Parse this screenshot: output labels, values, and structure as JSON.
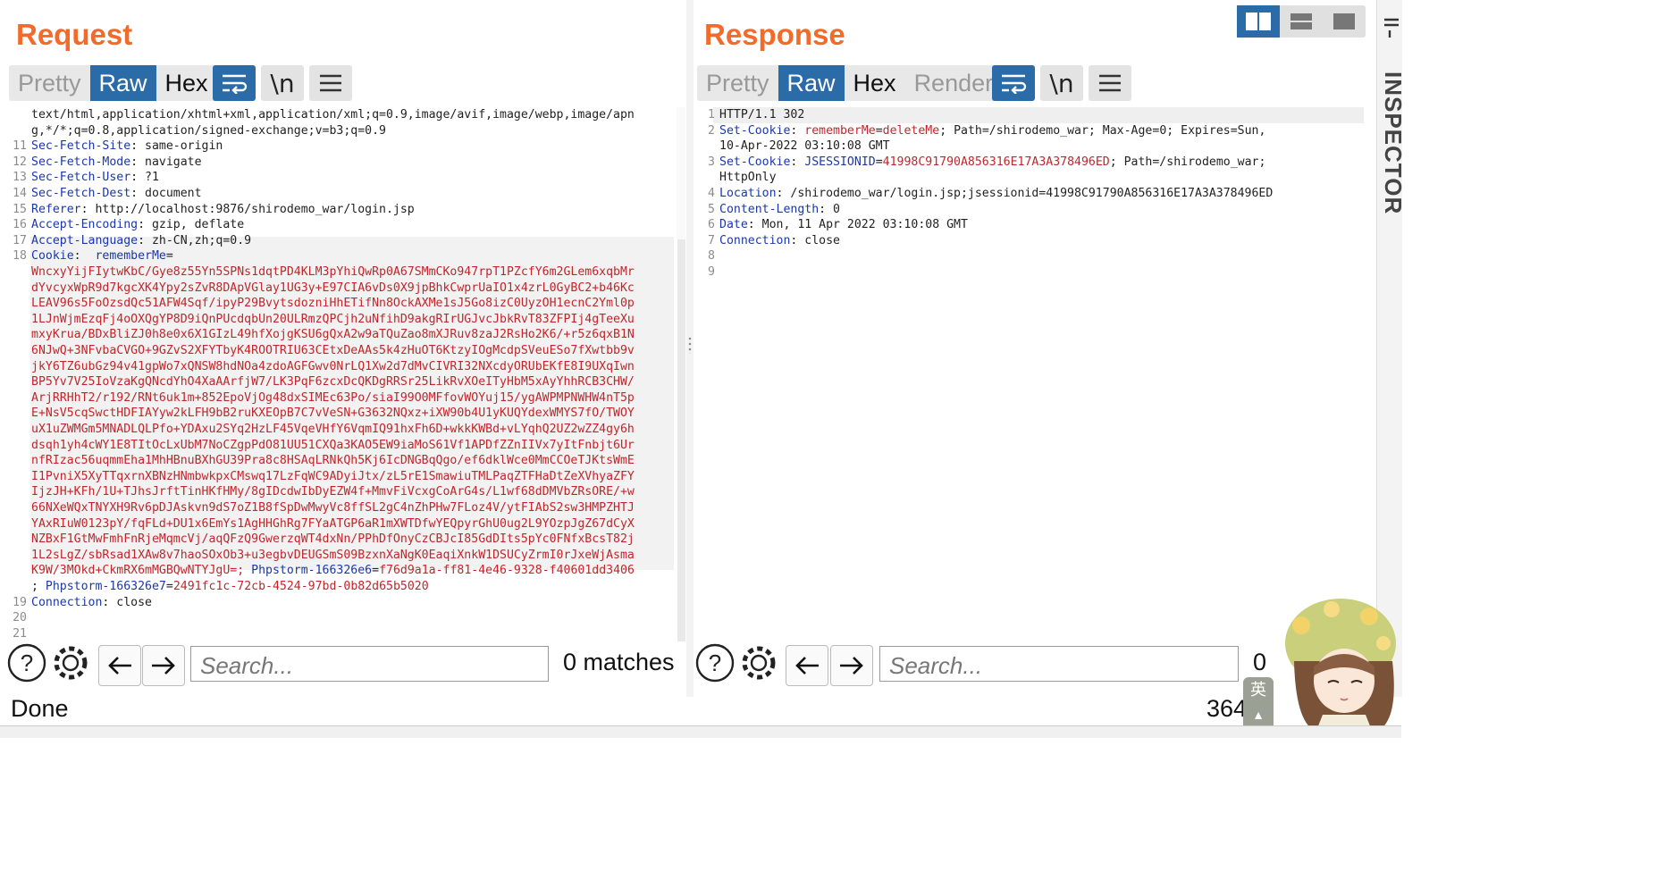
{
  "request": {
    "title": "Request",
    "tabs": [
      "Pretty",
      "Raw",
      "Hex"
    ],
    "active_tab": "Raw",
    "newline_label": "\\n",
    "lines": [
      {
        "n": "",
        "parts": [
          [
            "v",
            "text/html,application/xhtml+xml,application/xml;q=0.9,image/avif,image/webp,image/apn"
          ]
        ]
      },
      {
        "n": "",
        "parts": [
          [
            "v",
            "g,*/*;q=0.8,application/signed-exchange;v=b3;q=0.9"
          ]
        ]
      },
      {
        "n": "11",
        "parts": [
          [
            "k",
            "Sec-Fetch-Site"
          ],
          [
            "v",
            ": same-origin"
          ]
        ]
      },
      {
        "n": "12",
        "parts": [
          [
            "k",
            "Sec-Fetch-Mode"
          ],
          [
            "v",
            ": navigate"
          ]
        ]
      },
      {
        "n": "13",
        "parts": [
          [
            "k",
            "Sec-Fetch-User"
          ],
          [
            "v",
            ": ?1"
          ]
        ]
      },
      {
        "n": "14",
        "parts": [
          [
            "k",
            "Sec-Fetch-Dest"
          ],
          [
            "v",
            ": document"
          ]
        ]
      },
      {
        "n": "15",
        "parts": [
          [
            "k",
            "Referer"
          ],
          [
            "v",
            ": http://localhost:9876/shirodemo_war/login.jsp"
          ]
        ]
      },
      {
        "n": "16",
        "parts": [
          [
            "k",
            "Accept-Encoding"
          ],
          [
            "v",
            ": gzip, deflate"
          ]
        ]
      },
      {
        "n": "17",
        "parts": [
          [
            "k",
            "Accept-Language"
          ],
          [
            "v",
            ": zh-CN,zh;q=0.9"
          ]
        ]
      },
      {
        "n": "18",
        "parts": [
          [
            "k",
            "Cookie"
          ],
          [
            "v",
            ":  "
          ],
          [
            "k",
            "rememberMe"
          ],
          [
            "v",
            "="
          ]
        ]
      },
      {
        "n": "",
        "parts": [
          [
            "r",
            "WncxyYijFIytwKbC/Gye8z55Yn5SPNs1dqtPD4KLM3pYhiQwRp0A67SMmCKo947rpT1PZcfY6m2GLem6xqbMr"
          ]
        ]
      },
      {
        "n": "",
        "parts": [
          [
            "r",
            "dYvcyxWpR9d7kgcXK4Ypy2sZvR8DApVGlay1UG3y+E97CIA6vDs0X9jpBhkCwprUaIO1x4zrL0GyBC2+b46Kc"
          ]
        ]
      },
      {
        "n": "",
        "parts": [
          [
            "r",
            "LEAV96s5FoOzsdQc51AFW4Sqf/ipyP29BvytsdozniHhETifNn8OckAXMe1sJ5Go8izC0UyzOH1ecnC2Yml0p"
          ]
        ]
      },
      {
        "n": "",
        "parts": [
          [
            "r",
            "1LJnWjmEzqFj4oOXQgYP8D9iQnPUcdqbUn20ULRmzQPCjh2uNfihD9akgRIrUGJvcJbkRvT83ZFPIj4gTeeXu"
          ]
        ]
      },
      {
        "n": "",
        "parts": [
          [
            "r",
            "mxyKrua/BDxBliZJ0h8e0x6X1GIzL49hfXojgKSU6gQxA2w9aTQuZao8mXJRuv8zaJ2RsHo2K6/+r5z6qxB1N"
          ]
        ]
      },
      {
        "n": "",
        "parts": [
          [
            "r",
            "6NJwQ+3NFvbaCVGO+9GZvS2XFYTbyK4ROOTRIU63CEtxDeAAs5k4zHuOT6KtzyIOgMcdpSVeuESo7fXwtbb9v"
          ]
        ]
      },
      {
        "n": "",
        "parts": [
          [
            "r",
            "jkY6TZ6ubGz94v41gpWo7xQNSW8hdNOa4zdoAGFGwv0NrLQ1Xw2d7dMvCIVRI32NXcdyORUbEKfE8I9UXqIwn"
          ]
        ]
      },
      {
        "n": "",
        "parts": [
          [
            "r",
            "BP5Yv7V25IoVzaKgQNcdYhO4XaAArfjW7/LK3PqF6zcxDcQKDgRRSr25LikRvXOeITyHbM5xAyYhhRCB3CHW/"
          ]
        ]
      },
      {
        "n": "",
        "parts": [
          [
            "r",
            "ArjRRHhT2/r192/RNt6uk1m+852EpoVjOg48dxSIMEc63Po/siaI99O0MFfovWOYuj15/ygAWPMPNWHW4nT5p"
          ]
        ]
      },
      {
        "n": "",
        "parts": [
          [
            "r",
            "E+NsV5cqSwctHDFIAYyw2kLFH9bB2ruKXEOpB7C7vVeSN+G3632NQxz+iXW90b4U1yKUQYdexWMYS7fO/TWOY"
          ]
        ]
      },
      {
        "n": "",
        "parts": [
          [
            "r",
            "uX1uZWMGm5MNADLQLPfo+YDAxu2SYq2HzLF45VqeVHfY6VqmIQ91hxFh6D+wkkKWBd+vLYqhQ2UZ2wZZ4gy6h"
          ]
        ]
      },
      {
        "n": "",
        "parts": [
          [
            "r",
            "dsqh1yh4cWY1E8TItOcLxUbM7NoCZgpPdO81UU51CXQa3KAO5EW9iaMoS61Vf1APDfZZnIIVx7yItFnbjt6Ur"
          ]
        ]
      },
      {
        "n": "",
        "parts": [
          [
            "r",
            "nfRIzac56uqmmEha1MhHBnuBXhGU39Pra8c8HSAqLRNkQh5Kj6IcDNGBqQgo/ef6dklWce0MmCCOeTJKtsWmE"
          ]
        ]
      },
      {
        "n": "",
        "parts": [
          [
            "r",
            "I1PvniX5XyTTqxrnXBNzHNmbwkpxCMswq17LzFqWC9ADyiJtx/zL5rE1SmawiuTMLPaqZTFHaDtZeXVhyaZFY"
          ]
        ]
      },
      {
        "n": "",
        "parts": [
          [
            "r",
            "IjzJH+KFh/1U+TJhsJrftTinHKfHMy/8gIDcdwIbDyEZW4f+MmvFiVcxgCoArG4s/L1wf68dDMVbZRsORE/+w"
          ]
        ]
      },
      {
        "n": "",
        "parts": [
          [
            "r",
            "66NXeWQxTNYXH9Rv6pDJAskvn9dS7oZ1B8fSpDwMwyVc8ffSL2gC4nZhPHw7FLoz4V/ytFIAbS2sw3HMPZHTJ"
          ]
        ]
      },
      {
        "n": "",
        "parts": [
          [
            "r",
            "YAxRIuW0123pY/fqFLd+DU1x6EmYs1AgHHGhRg7FYaATGP6aR1mXWTDfwYEQpyrGhU0ug2L9YOzpJgZ67dCyX"
          ]
        ]
      },
      {
        "n": "",
        "parts": [
          [
            "r",
            "NZBxF1GtMwFmhFnRjeMqmcVj/aqQFzQ9GwerzqWT4dxNn/PPhDfOnyCzCBJcI85GdDIts5pYc0FNfxBcsT82j"
          ]
        ]
      },
      {
        "n": "",
        "parts": [
          [
            "r",
            "1L2sLgZ/sbRsad1XAw8v7haoSOxOb3+u3egbvDEUGSmS09BzxnXaNgK0EaqiXnkW1DSUCyZrmI0rJxeWjAsma"
          ]
        ]
      },
      {
        "n": "",
        "parts": [
          [
            "r",
            "K9W/3MOkd+CkmRX6mMGBQwNTYJgU=; "
          ],
          [
            "k",
            "Phpstorm-166326e6"
          ],
          [
            "v",
            "="
          ],
          [
            "r",
            "f76d9a1a-ff81-4e46-9328-f40601dd3406"
          ]
        ]
      },
      {
        "n": "",
        "parts": [
          [
            "v",
            "; "
          ],
          [
            "k",
            "Phpstorm-166326e7"
          ],
          [
            "v",
            "="
          ],
          [
            "r",
            "2491fc1c-72cb-4524-97bd-0b82d65b5020"
          ]
        ]
      },
      {
        "n": "19",
        "parts": [
          [
            "k",
            "Connection"
          ],
          [
            "v",
            ": close"
          ]
        ]
      },
      {
        "n": "20",
        "parts": []
      },
      {
        "n": "21",
        "parts": []
      }
    ],
    "search_placeholder": "Search...",
    "matches": "0 matches"
  },
  "response": {
    "title": "Response",
    "tabs": [
      "Pretty",
      "Raw",
      "Hex",
      "Render"
    ],
    "active_tab": "Raw",
    "newline_label": "\\n",
    "lines": [
      {
        "n": "1",
        "parts": [
          [
            "v",
            "HTTP/1.1 302"
          ]
        ]
      },
      {
        "n": "2",
        "parts": [
          [
            "k",
            "Set-Cookie"
          ],
          [
            "v",
            ": "
          ],
          [
            "r",
            "rememberMe"
          ],
          [
            "v",
            "="
          ],
          [
            "r",
            "deleteMe"
          ],
          [
            "v",
            "; Path=/shirodemo_war; Max-Age=0; Expires=Sun,"
          ]
        ]
      },
      {
        "n": "",
        "parts": [
          [
            "v",
            "10-Apr-2022 03:10:08 GMT"
          ]
        ]
      },
      {
        "n": "3",
        "parts": [
          [
            "k",
            "Set-Cookie"
          ],
          [
            "v",
            ": "
          ],
          [
            "k",
            "JSESSIONID"
          ],
          [
            "v",
            "="
          ],
          [
            "r",
            "41998C91790A856316E17A3A378496ED"
          ],
          [
            "v",
            "; Path=/shirodemo_war;"
          ]
        ]
      },
      {
        "n": "",
        "parts": [
          [
            "v",
            "HttpOnly"
          ]
        ]
      },
      {
        "n": "4",
        "parts": [
          [
            "k",
            "Location"
          ],
          [
            "v",
            ": /shirodemo_war/login.jsp;jsessionid=41998C91790A856316E17A3A378496ED"
          ]
        ]
      },
      {
        "n": "5",
        "parts": [
          [
            "k",
            "Content-Length"
          ],
          [
            "v",
            ": 0"
          ]
        ]
      },
      {
        "n": "6",
        "parts": [
          [
            "k",
            "Date"
          ],
          [
            "v",
            ": Mon, 11 Apr 2022 03:10:08 GMT"
          ]
        ]
      },
      {
        "n": "7",
        "parts": [
          [
            "k",
            "Connection"
          ],
          [
            "v",
            ": close"
          ]
        ]
      },
      {
        "n": "8",
        "parts": []
      },
      {
        "n": "9",
        "parts": []
      }
    ],
    "search_placeholder": "Search...",
    "matches": "0"
  },
  "status": {
    "left": "Done",
    "right": "364"
  },
  "inspector_label": "INSPECTOR",
  "ime_label": "英",
  "colors": {
    "accent_orange": "#f26b2a",
    "tab_blue": "#2a6ba8",
    "header_key": "#1c37a9",
    "value_red": "#c0262b"
  }
}
